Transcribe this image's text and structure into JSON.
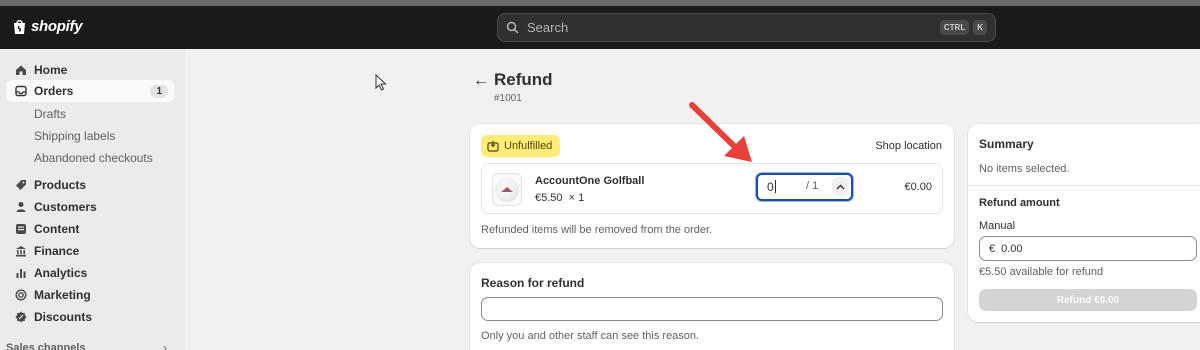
{
  "topbar": {
    "brand": "shopify",
    "search_placeholder": "Search",
    "shortcut_keys": [
      "CTRL",
      "K"
    ]
  },
  "sidebar": {
    "items": [
      {
        "label": "Home",
        "icon": "home-icon"
      },
      {
        "label": "Orders",
        "icon": "orders-icon",
        "badge": "1",
        "active": true
      },
      {
        "label": "Products",
        "icon": "tag-icon"
      },
      {
        "label": "Customers",
        "icon": "person-icon"
      },
      {
        "label": "Content",
        "icon": "content-icon"
      },
      {
        "label": "Finance",
        "icon": "bank-icon"
      },
      {
        "label": "Analytics",
        "icon": "bar-chart-icon"
      },
      {
        "label": "Marketing",
        "icon": "target-icon"
      },
      {
        "label": "Discounts",
        "icon": "discount-icon"
      }
    ],
    "order_subitems": [
      "Drafts",
      "Shipping labels",
      "Abandoned checkouts"
    ],
    "sales_channels_label": "Sales channels"
  },
  "page": {
    "title": "Refund",
    "order_number": "#1001"
  },
  "fulfillment_card": {
    "status_badge": "Unfulfilled",
    "location": "Shop location",
    "line_item": {
      "name": "AccountOne Golfball",
      "unit_price": "€5.50",
      "quantity_text": "× 1",
      "refund_qty_value": "0",
      "refund_qty_max": "/ 1",
      "line_total": "€0.00"
    },
    "note": "Refunded items will be removed from the order."
  },
  "reason_card": {
    "title": "Reason for refund",
    "value": "",
    "help": "Only you and other staff can see this reason."
  },
  "summary_card": {
    "title": "Summary",
    "empty_text": "No items selected.",
    "refund_amount_title": "Refund amount",
    "manual_label": "Manual",
    "currency_symbol": "€",
    "amount_value": "0.00",
    "available_text": "€5.50 available for refund",
    "refund_button_label": "Refund €0.00"
  },
  "colors": {
    "topbar": "#1a1a1a",
    "badge_yellow": "#ffeb78",
    "focus_blue": "#1f4fa3",
    "annotation_red": "#e8413a"
  }
}
